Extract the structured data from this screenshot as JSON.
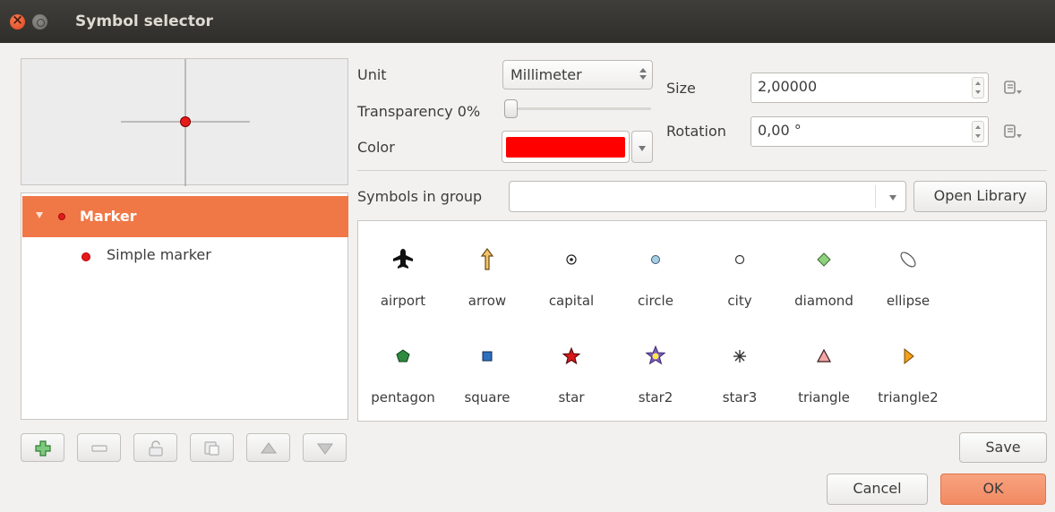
{
  "window": {
    "title": "Symbol selector"
  },
  "layers": {
    "parent": "Marker",
    "child": "Simple marker"
  },
  "properties": {
    "unit_label": "Unit",
    "unit_value": "Millimeter",
    "transparency_label": "Transparency 0%",
    "transparency_value": 0,
    "color_label": "Color",
    "color_value": "#ff0000",
    "size_label": "Size",
    "size_value": "2,00000",
    "rotation_label": "Rotation",
    "rotation_value": "0,00 °"
  },
  "library": {
    "group_label": "Symbols in group",
    "group_value": "",
    "open_library_label": "Open Library",
    "symbols": [
      {
        "name": "airport",
        "icon": "airport-icon"
      },
      {
        "name": "arrow",
        "icon": "arrow-icon"
      },
      {
        "name": "capital",
        "icon": "capital-icon"
      },
      {
        "name": "circle",
        "icon": "circle-icon"
      },
      {
        "name": "city",
        "icon": "city-icon"
      },
      {
        "name": "diamond",
        "icon": "diamond-icon"
      },
      {
        "name": "ellipse",
        "icon": "ellipse-icon"
      },
      {
        "name": "pentagon",
        "icon": "pentagon-icon"
      },
      {
        "name": "square",
        "icon": "square-icon"
      },
      {
        "name": "star",
        "icon": "star-icon"
      },
      {
        "name": "star2",
        "icon": "star2-icon"
      },
      {
        "name": "star3",
        "icon": "star3-icon"
      },
      {
        "name": "triangle",
        "icon": "triangle-icon"
      },
      {
        "name": "triangle2",
        "icon": "triangle2-icon"
      }
    ]
  },
  "buttons": {
    "save": "Save",
    "cancel": "Cancel",
    "ok": "OK"
  }
}
